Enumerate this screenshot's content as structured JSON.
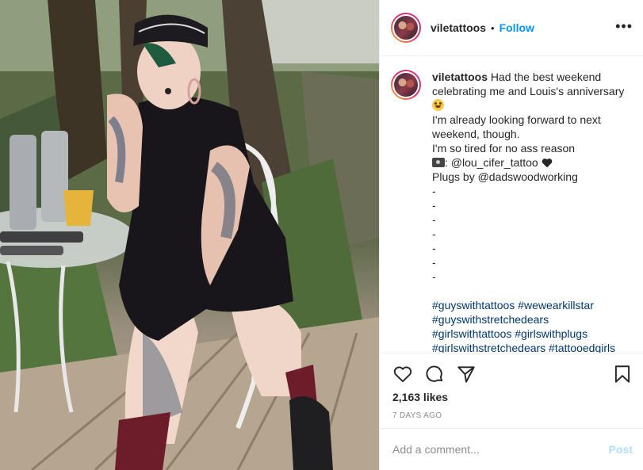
{
  "post": {
    "username": "viletattoos",
    "separator": "•",
    "follow_label": "Follow",
    "more_label": "•••"
  },
  "caption": {
    "username": "viletattoos",
    "line1": "Had the best weekend celebrating me and Louis's anniversary",
    "line2": "I'm already looking forward to next weekend, though.",
    "line3": "I'm so tired for no ass reason",
    "credit": ": @lou_cifer_tattoo",
    "plugs": "Plugs by @dadswoodworking",
    "dash": "-",
    "hashtags1": "#guyswithtattoos #wewearkillstar",
    "hashtags2": "#guyswithstretchedears",
    "hashtags3": "#girlswithtattoos #girlswithplugs",
    "hashtags4": "#girlswithstretchedears #tattooedgirls"
  },
  "stats": {
    "likes": "2,163 likes",
    "date": "7 DAYS AGO"
  },
  "comment": {
    "placeholder": "Add a comment...",
    "post_label": "Post"
  },
  "icons": {
    "like": "heart-outline-icon",
    "comment": "comment-bubble-icon",
    "share": "paper-plane-icon",
    "save": "bookmark-icon"
  }
}
